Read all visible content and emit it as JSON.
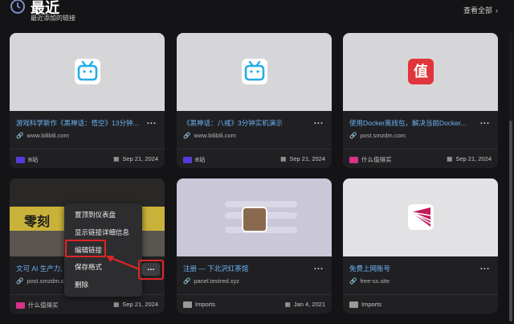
{
  "header": {
    "title": "最近",
    "subtitle": "最近添加的链接",
    "view_all": "查看全部"
  },
  "cards": [
    {
      "title": "游戏科学新作《黑神话：悟空》13分钟...",
      "url": "www.bilibili.com",
      "folder": "B站",
      "folder_color": "#5b3bd6",
      "date": "Sep 21, 2024",
      "logo": "bilibili-icon"
    },
    {
      "title": "《黑神话：八戒》3分钟实机演示",
      "url": "www.bilibili.com",
      "folder": "B站",
      "folder_color": "#5b3bd6",
      "date": "Sep 21, 2024",
      "logo": "bilibili-icon"
    },
    {
      "title": "使用Docker离线包，解决当前Docker...",
      "url": "post.smzdm.com",
      "folder": "什么值得买",
      "folder_color": "#d6338a",
      "date": "Sep 21, 2024",
      "logo": "smzdm-icon",
      "logo_text": "值"
    },
    {
      "title": "文可 AI 生产力,",
      "url": "post.smzdm.com",
      "folder": "什么值得买",
      "folder_color": "#d6338a",
      "date": "Sep 21, 2024",
      "thumb_text": "零刻"
    },
    {
      "title": "注册 — 下北沢红茶馆",
      "url": "panel.testred.xyz",
      "folder": "Imports",
      "folder_color": "#9a9a9a",
      "date": "Jan 4, 2021",
      "logo": "avatar-photo"
    },
    {
      "title": "免费上网账号",
      "url": "free-ss.site",
      "folder": "Imports",
      "folder_color": "#9a9a9a",
      "date": "",
      "logo": "pink-logo"
    }
  ],
  "context_menu": {
    "items": [
      "置顶到仪表盘",
      "显示链接详细信息",
      "编辑链接",
      "保存格式",
      "删除"
    ],
    "highlighted": "编辑链接"
  },
  "more_label": "...",
  "accent_colors": {
    "link": "#6db3f2",
    "highlight": "#e02424"
  }
}
